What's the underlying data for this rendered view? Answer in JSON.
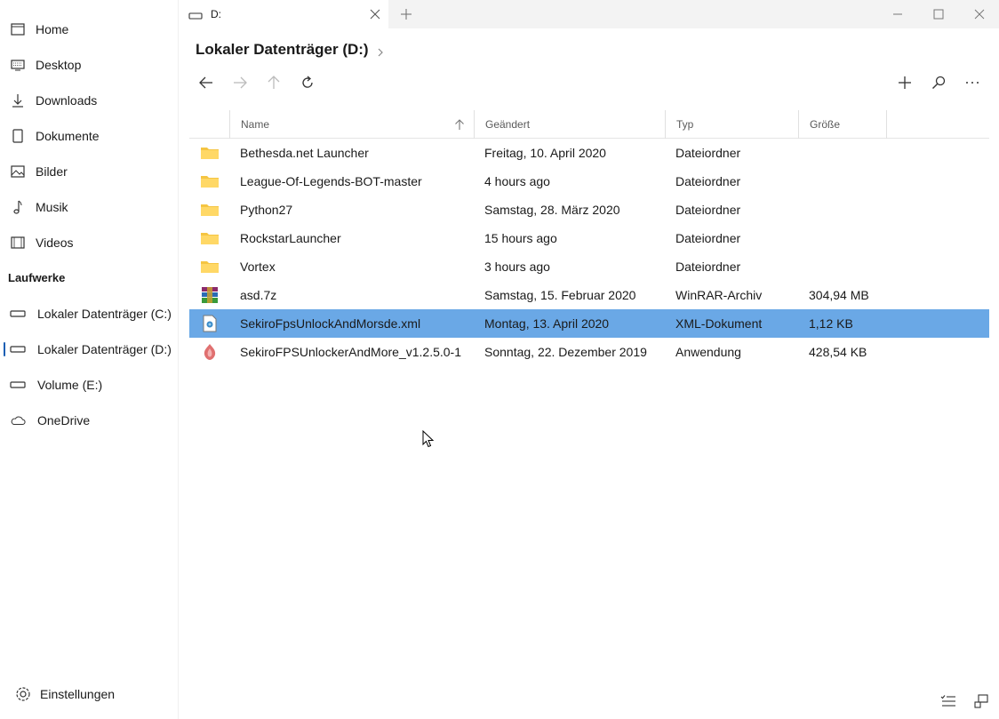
{
  "sidebar": {
    "items": [
      {
        "label": "Home",
        "icon": "home-icon"
      },
      {
        "label": "Desktop",
        "icon": "desktop-icon"
      },
      {
        "label": "Downloads",
        "icon": "download-icon"
      },
      {
        "label": "Dokumente",
        "icon": "document-icon"
      },
      {
        "label": "Bilder",
        "icon": "picture-icon"
      },
      {
        "label": "Musik",
        "icon": "music-icon"
      },
      {
        "label": "Videos",
        "icon": "video-icon"
      }
    ],
    "drives_header": "Laufwerke",
    "drives": [
      {
        "label": "Lokaler Datenträger (C:)",
        "icon": "drive-icon"
      },
      {
        "label": "Lokaler Datenträger (D:)",
        "icon": "drive-icon",
        "active": true
      },
      {
        "label": "Volume (E:)",
        "icon": "drive-icon"
      },
      {
        "label": "OneDrive",
        "icon": "cloud-icon"
      }
    ],
    "settings_label": "Einstellungen"
  },
  "tab": {
    "label": "D:"
  },
  "breadcrumb": {
    "label": "Lokaler Datenträger (D:)"
  },
  "columns": {
    "name": "Name",
    "modified": "Geändert",
    "type": "Typ",
    "size": "Größe"
  },
  "files": [
    {
      "icon": "folder-icon",
      "name": "Bethesda.net Launcher",
      "modified": "Freitag, 10. April 2020",
      "type": "Dateiordner",
      "size": ""
    },
    {
      "icon": "folder-icon",
      "name": "League-Of-Legends-BOT-master",
      "modified": "4 hours ago",
      "type": "Dateiordner",
      "size": ""
    },
    {
      "icon": "folder-icon",
      "name": "Python27",
      "modified": "Samstag, 28. März 2020",
      "type": "Dateiordner",
      "size": ""
    },
    {
      "icon": "folder-icon",
      "name": "RockstarLauncher",
      "modified": "15 hours ago",
      "type": "Dateiordner",
      "size": ""
    },
    {
      "icon": "folder-icon",
      "name": "Vortex",
      "modified": "3 hours ago",
      "type": "Dateiordner",
      "size": ""
    },
    {
      "icon": "winrar-archive-icon",
      "name": "asd.7z",
      "modified": "Samstag, 15. Februar 2020",
      "type": "WinRAR-Archiv",
      "size": "304,94 MB"
    },
    {
      "icon": "xml-document-icon",
      "name": "SekiroFpsUnlockAndMorsde.xml",
      "modified": "Montag, 13. April 2020",
      "type": "XML-Dokument",
      "size": "1,12 KB",
      "selected": true
    },
    {
      "icon": "application-icon",
      "name": "SekiroFPSUnlockerAndMore_v1.2.5.0-1",
      "modified": "Sonntag, 22. Dezember 2019",
      "type": "Anwendung",
      "size": "428,54 KB"
    }
  ],
  "colors": {
    "selection": "#6aa8e6",
    "folder": "#f5c542",
    "accent": "#1a5fb4"
  }
}
